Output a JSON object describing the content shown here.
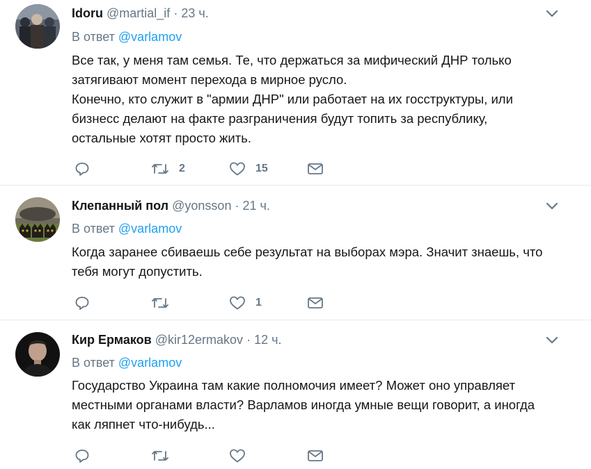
{
  "tweets": [
    {
      "name": "Idoru",
      "handle": "@martial_if",
      "time": "· 23 ч.",
      "reply_prefix": "В ответ",
      "reply_to": "@varlamov",
      "text": "Все так, у меня там семья. Те, что держаться за мифический ДНР только\nзатягивают момент  перехода в мирное русло.\nКонечно, кто служит в \"армии ДНР\" или работает на их госструктуры, или\nбизнесс делают на факте разграничения будут топить за республику,\nостальные хотят просто жить.",
      "retweets": "2",
      "likes": "15"
    },
    {
      "name": "Клепанный пол",
      "handle": "@yonsson",
      "time": "· 21 ч.",
      "reply_prefix": "В ответ",
      "reply_to": "@varlamov",
      "text": "Когда заранее сбиваешь себе результат на выборах мэра. Значит знаешь, что\nтебя могут допустить.",
      "retweets": "",
      "likes": "1"
    },
    {
      "name": "Кир Ермаков",
      "handle": "@kir12ermakov",
      "time": "· 12 ч.",
      "reply_prefix": "В ответ",
      "reply_to": "@varlamov",
      "text": "Государство Украина там какие полномочия имеет? Может оно управляет\nместными органами власти? Варламов иногда умные вещи говорит, а иногда\nкак ляпнет что-нибудь...",
      "retweets": "",
      "likes": ""
    }
  ],
  "icons": {
    "reply": "reply-icon",
    "retweet": "retweet-icon",
    "like": "heart-icon",
    "dm": "envelope-icon",
    "more": "chevron-down-icon"
  },
  "colors": {
    "icon": "#657786",
    "link": "#1da1f2",
    "divider": "#e6ecf0"
  }
}
